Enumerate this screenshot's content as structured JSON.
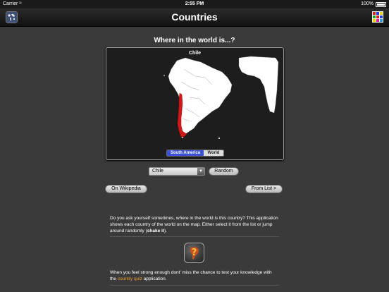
{
  "status_bar": {
    "carrier": "Carrier",
    "time": "2:55 PM",
    "battery": "100%"
  },
  "nav": {
    "title": "Countries",
    "left_icon": "world-map-icon",
    "right_icon": "color-grid-icon",
    "grid_colors": [
      "#e02020",
      "#2040e0",
      "#f0d000",
      "#20a020",
      "#e02020",
      "#2040e0",
      "#f0d000",
      "#e020a0",
      "#20a0e0"
    ]
  },
  "heading": "Where in the world is...?",
  "map": {
    "country": "Chile",
    "highlight_color": "#d01818",
    "land_color": "#ffffff",
    "segments": {
      "south_america": "South America",
      "world": "World",
      "selected": "South America"
    },
    "accent": "#3b52d8"
  },
  "controls": {
    "selected_country": "Chile",
    "random_label": "Random",
    "wikipedia_label": "On Wikipedia",
    "from_list_label": "From List >"
  },
  "description": {
    "text_before": "Do you ask yourself sometimes, where in the world is this country? This application shows each country of the world on the map. Either select it from the list or jump around randomly (",
    "bold": "shake it",
    "text_after": ")."
  },
  "promo": {
    "text_before": "When you feel strong enough dont' miss the chance to test your knowledge with the ",
    "link": "country quiz",
    "text_after": " application.",
    "icon": "country-quiz-app-icon"
  }
}
